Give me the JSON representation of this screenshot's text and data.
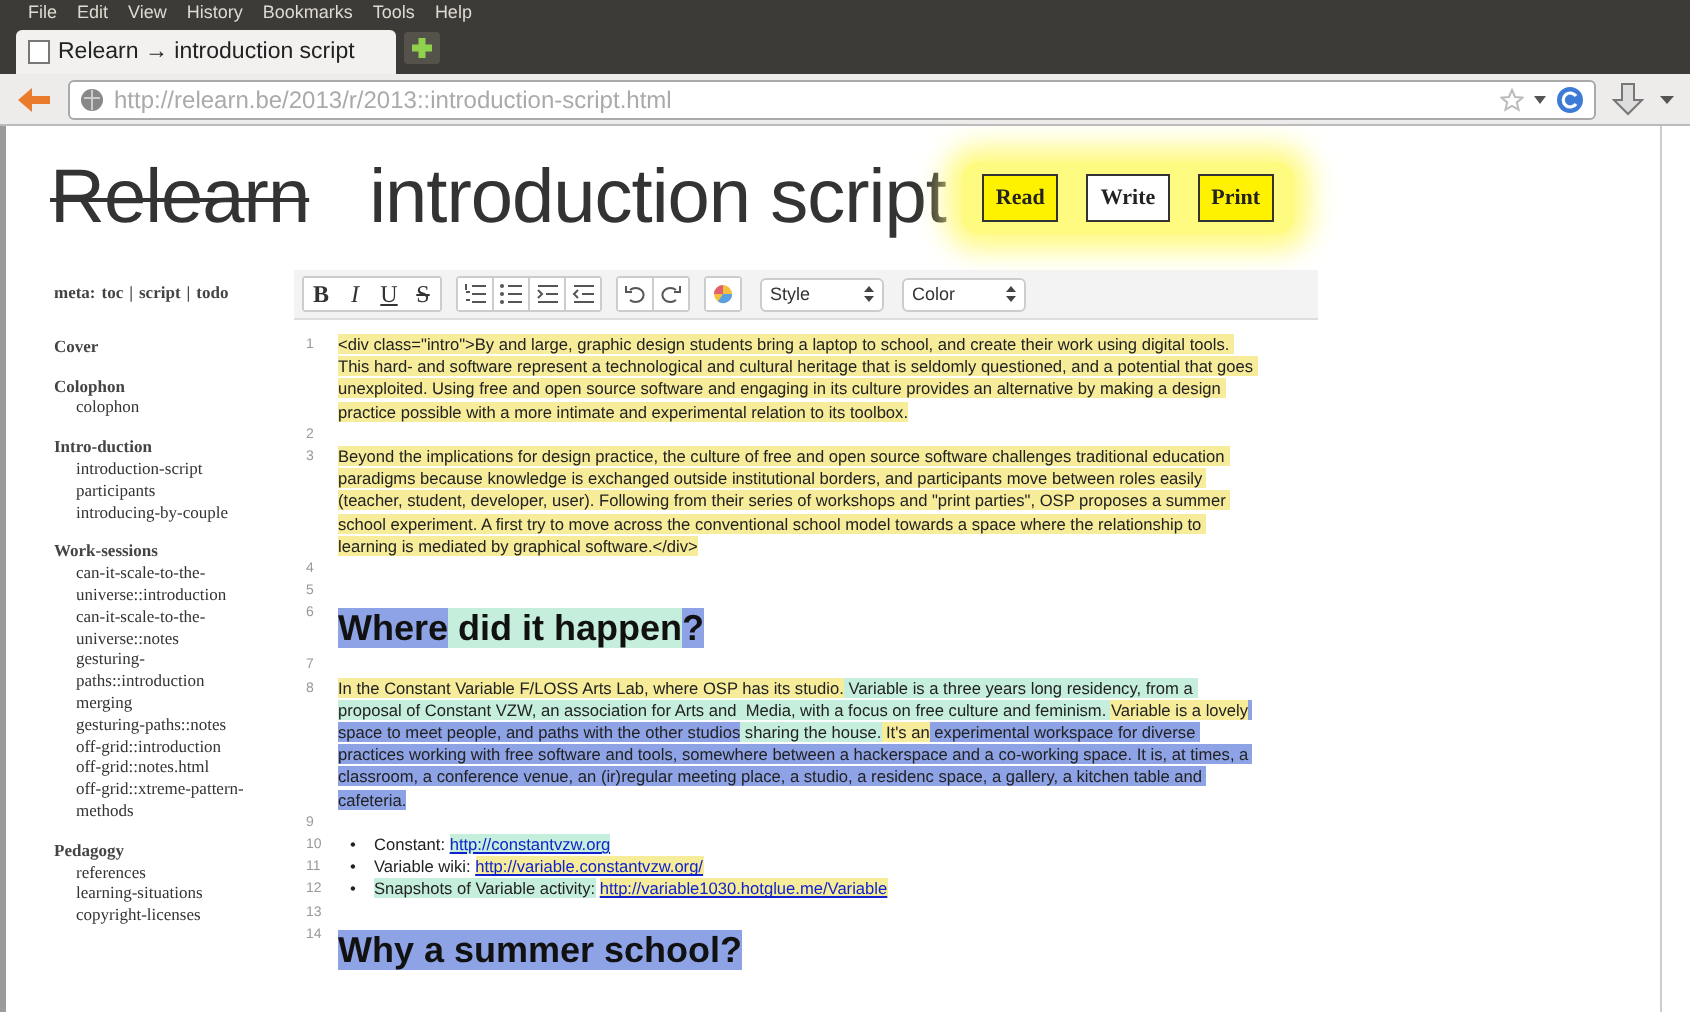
{
  "browser": {
    "menu": [
      "File",
      "Edit",
      "View",
      "History",
      "Bookmarks",
      "Tools",
      "Help"
    ],
    "tab": {
      "title": "Relearn → introduction script"
    },
    "url": "http://relearn.be/2013/r/2013::introduction-script.html"
  },
  "header": {
    "logo": "Relearn",
    "title": "introduction script",
    "buttons": [
      {
        "label": "Read",
        "selected": false
      },
      {
        "label": "Write",
        "selected": true
      },
      {
        "label": "Print",
        "selected": false
      }
    ]
  },
  "sidebar": {
    "meta": {
      "label": "meta:",
      "separator": "|",
      "links": [
        "toc",
        "script",
        "todo"
      ]
    },
    "sections": [
      {
        "title": "Cover"
      },
      {
        "title": "Colophon",
        "children": [
          "colophon"
        ]
      },
      {
        "title": "Intro-duction",
        "children": [
          "introduction-script",
          "participants",
          "introducing-by-couple"
        ]
      },
      {
        "title": "Work-sessions",
        "children": [
          "can-it-scale-to-the-universe::introduction",
          "can-it-scale-to-the-universe::notes",
          "gesturing-paths::introduction",
          "merging",
          "gesturing-paths::notes",
          "off-grid::introduction",
          "off-grid::notes.html",
          "off-grid::xtreme-pattern-methods"
        ]
      },
      {
        "title": "Pedagogy",
        "children": [
          "references",
          "learning-situations",
          "copyright-licenses"
        ]
      }
    ]
  },
  "editor": {
    "toolbar": {
      "format": [
        "B",
        "I",
        "U",
        "S"
      ],
      "selects": [
        "Style",
        "Color"
      ]
    },
    "lines": [
      {
        "number": "1",
        "kind": "paragraph",
        "segments": [
          {
            "text": "<div class=\"intro\">By and large, graphic design students bring a laptop to school, and create their work using digital tools. This hard- and software represent a technological and cultural heritage that is seldomly questioned, and a potential that goes unexploited. Using free and open source software and engaging in its culture provides an alternative by making a design practice possible with a more intimate and experimental relation to its toolbox.",
            "color": "#f6ec9a"
          }
        ]
      },
      {
        "number": "2",
        "kind": "blank"
      },
      {
        "number": "3",
        "kind": "paragraph",
        "segments": [
          {
            "text": "Beyond the implications for design practice, the culture of free and open source software challenges traditional education paradigms because knowledge is exchanged outside institutional borders, and participants move between roles easily (teacher, student, developer, user). Following from their series of workshops and \"print parties\", OSP proposes a summer school experiment. A first try to move across the conventional school model towards a space where the relationship to learning is mediated by graphical software.</div>",
            "color": "#f6ec9a"
          }
        ]
      },
      {
        "number": "4",
        "kind": "blank"
      },
      {
        "number": "5",
        "kind": "blank"
      },
      {
        "number": "6",
        "kind": "heading",
        "segments": [
          {
            "text": "Where",
            "color": "#8ea2e6"
          },
          {
            "text": " did it happen",
            "color": "#c6eedc"
          },
          {
            "text": "?",
            "color": "#8ea2e6"
          }
        ]
      },
      {
        "number": "7",
        "kind": "blank"
      },
      {
        "number": "8",
        "kind": "paragraph",
        "segments": [
          {
            "text": "In the Constant Variable F/LOSS Arts Lab, where OSP has its studio.",
            "color": "#f6ec9a"
          },
          {
            "text": " Variable is a three years long residency, from a proposal of Constant VZW, an association for Arts and  Media, with a focus on free culture and feminism. ",
            "color": "#c6eedc"
          },
          {
            "text": "Variable is a lovely",
            "color": "#f6ec9a"
          },
          {
            "text": " space to meet people, and paths with the other studios",
            "color": "#8ea2e6"
          },
          {
            "text": " sharing the house.",
            "color": "#c6eedc"
          },
          {
            "text": " It's an",
            "color": "#f6ec9a"
          },
          {
            "text": " experimental workspace for diverse practices working with free software and tools, somewhere between a hackerspace and a co-working space. It is, at times, a classroom, a conference venue, an (ir)regular meeting place, a studio, a residenc space, a gallery, a kitchen table and cafeteria.",
            "color": "#8ea2e6"
          }
        ]
      },
      {
        "number": "9",
        "kind": "blank"
      },
      {
        "number": "10",
        "kind": "bullet",
        "marker": "•",
        "segments": [
          {
            "kind": "text",
            "text": "Constant:",
            "color": "#ffffff"
          },
          {
            "kind": "link",
            "text": "http://constantvzw.org",
            "color": "#c6eedc"
          }
        ]
      },
      {
        "number": "11",
        "kind": "bullet",
        "marker": "•",
        "segments": [
          {
            "kind": "text",
            "text": "Variable wiki:",
            "color": "#ffffff"
          },
          {
            "kind": "link",
            "text": "http://variable.constantvzw.org/",
            "color": "#f6ec9a"
          }
        ]
      },
      {
        "number": "12",
        "kind": "bullet",
        "marker": "•",
        "segments": [
          {
            "kind": "text",
            "text": "Snapshots of Variable activity:",
            "color": "#c6eedc"
          },
          {
            "kind": "link",
            "text": "http://variable1030.hotglue.me/Variable",
            "color": "#f6ec9a"
          }
        ]
      },
      {
        "number": "13",
        "kind": "blank"
      },
      {
        "number": "14",
        "kind": "heading",
        "segments": [
          {
            "text": "Why a summer school?",
            "color": "#8ea2e6"
          }
        ]
      }
    ]
  }
}
